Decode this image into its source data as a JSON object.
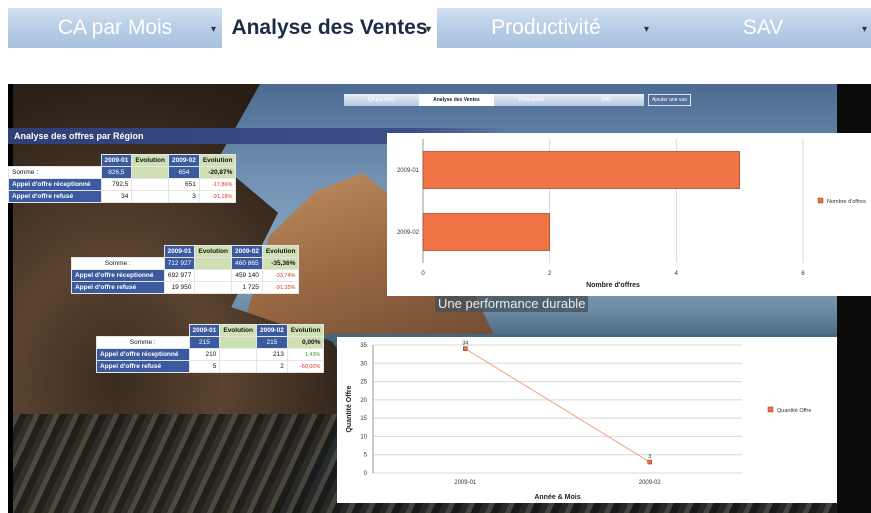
{
  "topnav": {
    "tabs": [
      {
        "label": "CA par Mois",
        "active": false
      },
      {
        "label": "Analyse des Ventes",
        "active": true
      },
      {
        "label": "Productivité",
        "active": false
      },
      {
        "label": "SAV",
        "active": false
      }
    ],
    "dropdown_glyph": "▾"
  },
  "mininav": {
    "tabs": [
      "CA par Mois",
      "Analyse des Ventes",
      "Productivité",
      "SAV"
    ],
    "add_view": "Ajouter une vue"
  },
  "section": {
    "title": "Analyse des offres par Région"
  },
  "tagline": "Une performance durable",
  "colors": {
    "header_blue": "#3c5aa0",
    "header_green": "#cfe0b5",
    "bar_orange": "#f07346",
    "neg_red": "#e03020",
    "pos_green": "#3a9a30"
  },
  "tables": [
    {
      "headers": [
        "2009-01",
        "Evolution",
        "2009-02",
        "Evolution"
      ],
      "sum_label": "Somme :",
      "sum": [
        "826,5",
        "",
        "654",
        "-20,87%"
      ],
      "rows": [
        {
          "label": "Appel d'offre réceptionné",
          "c1": "792,5",
          "c2": "",
          "c3": "651",
          "c4": "-17,86%"
        },
        {
          "label": "Appel d'offre refusé",
          "c1": "34",
          "c2": "",
          "c3": "3",
          "c4": "-91,18%"
        }
      ]
    },
    {
      "headers": [
        "2009-01",
        "Evolution",
        "2009-02",
        "Evolution"
      ],
      "sum_label": "Somme :",
      "sum": [
        "712 927",
        "",
        "460 865",
        "-35,36%"
      ],
      "rows": [
        {
          "label": "Appel d'offre réceptionné",
          "c1": "692 977",
          "c2": "",
          "c3": "459 140",
          "c4": "-33,74%"
        },
        {
          "label": "Appel d'offre refusé",
          "c1": "19 950",
          "c2": "",
          "c3": "1 725",
          "c4": "-91,35%"
        }
      ]
    },
    {
      "headers": [
        "2009-01",
        "Evolution",
        "2009-02",
        "Evolution"
      ],
      "sum_label": "Somme :",
      "sum": [
        "215",
        "",
        "215",
        "0,00%"
      ],
      "rows": [
        {
          "label": "Appel d'offre réceptionné",
          "c1": "210",
          "c2": "",
          "c3": "213",
          "c4": "1,43%"
        },
        {
          "label": "Appel d'offre refusé",
          "c1": "5",
          "c2": "",
          "c3": "2",
          "c4": "-60,00%"
        }
      ]
    }
  ],
  "chart_data": [
    {
      "type": "bar",
      "orientation": "horizontal",
      "categories": [
        "2009-01",
        "2009-02"
      ],
      "series": [
        {
          "name": "Nombre d'offres",
          "values": [
            5,
            2
          ]
        }
      ],
      "xlabel": "Nombre d'offres",
      "ylabel": "",
      "xlim": [
        0,
        6
      ],
      "xticks": [
        "0",
        "2",
        "4",
        "6"
      ],
      "grid": true,
      "legend": "right",
      "color": "#f07346"
    },
    {
      "type": "line",
      "categories": [
        "2009-01",
        "2009-02"
      ],
      "series": [
        {
          "name": "Quantité Offre",
          "values": [
            34,
            3
          ]
        }
      ],
      "data_labels": [
        "34",
        "3"
      ],
      "xlabel": "Année & Mois",
      "ylabel": "Quantité Offre",
      "ylim": [
        0,
        35
      ],
      "yticks": [
        "0",
        "5",
        "10",
        "15",
        "20",
        "25",
        "30",
        "35"
      ],
      "grid": true,
      "legend": "right",
      "color": "#f07346"
    }
  ]
}
